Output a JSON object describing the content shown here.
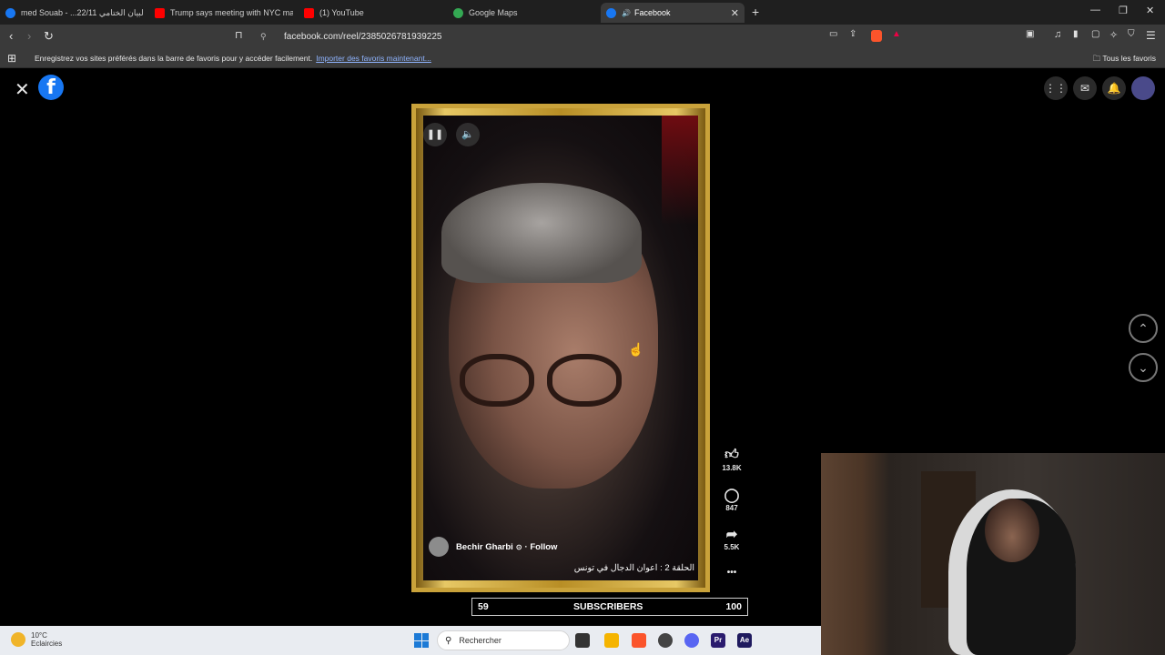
{
  "browser": {
    "tabs": [
      {
        "label": "med Souab - ...22/11 البيان الختامي",
        "favicon_color": "#1877f2"
      },
      {
        "label": "Trump says meeting with NYC mayor",
        "favicon_color": "#ff0000"
      },
      {
        "label": "(1) YouTube",
        "favicon_color": "#ff0000"
      },
      {
        "label": "Google Maps",
        "favicon_color": "#34a853"
      },
      {
        "label": "Facebook",
        "favicon_color": "#1877f2",
        "active": true
      }
    ],
    "new_tab": "+",
    "url": "facebook.com/reel/2385026781939225",
    "bookmarks_message": "Enregistrez vos sites préférés dans la barre de favoris pour y accéder facilement.",
    "bookmarks_link": "Importer des favoris maintenant...",
    "all_bookmarks": "Tous les favoris"
  },
  "reel": {
    "author": "Bechir Gharbi",
    "follow": "· Follow",
    "caption": "الحلقة 2 : اعوان الدجال في تونس",
    "likes": "13.8K",
    "comments": "847",
    "shares": "5.5K",
    "more": "•••"
  },
  "subscribers_bar": {
    "current": "59",
    "label": "SUBSCRIBERS",
    "goal": "100"
  },
  "taskbar": {
    "temperature": "10°C",
    "condition": "Eclaircies",
    "search_placeholder": "Rechercher",
    "apps": [
      {
        "label": "",
        "color": "#333333"
      },
      {
        "label": "",
        "color": "#f5b400"
      },
      {
        "label": "",
        "color": "#fb542b"
      },
      {
        "label": "",
        "color": "#444444"
      },
      {
        "label": "",
        "color": "#5865f2"
      },
      {
        "label": "Pr",
        "color": "#2a1b6e"
      },
      {
        "label": "Ae",
        "color": "#1f1a5e"
      }
    ]
  },
  "colors": {
    "fb_blue": "#1877f2",
    "frame_gold": "#c9a23a"
  }
}
